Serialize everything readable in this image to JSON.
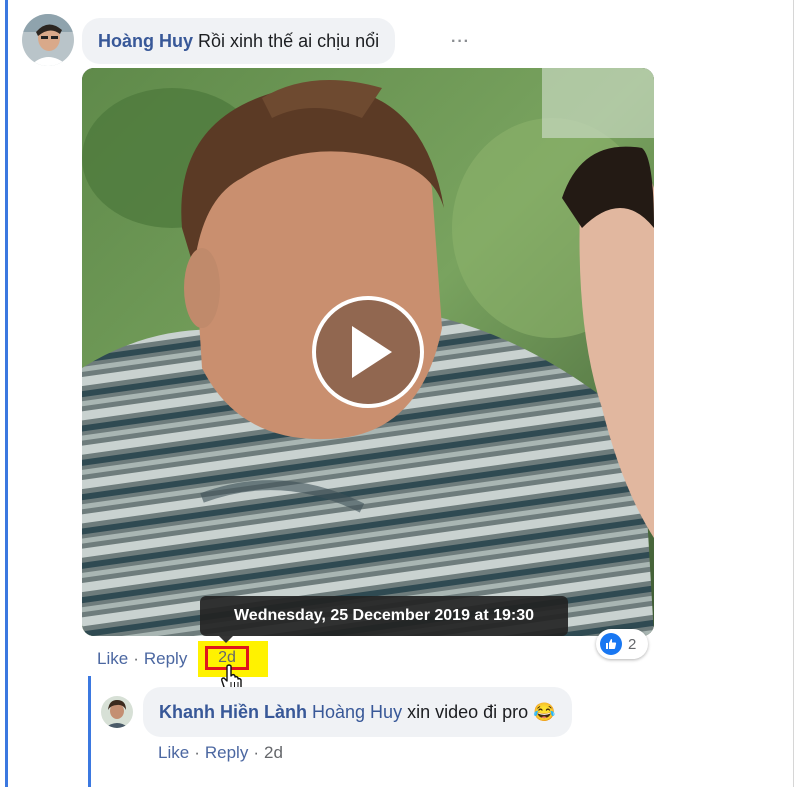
{
  "comment": {
    "author": "Hoàng Huy",
    "text": "Rồi xinh thế ai chịu nổi",
    "more_icon": "···",
    "like_label": "Like",
    "reply_label": "Reply",
    "separator": "·",
    "timestamp": "2d",
    "reaction_count": "2",
    "reaction_icon": "thumbs-up",
    "tooltip": "Wednesday, 25 December 2019 at 19:30"
  },
  "reply": {
    "author": "Khanh Hiền Lành",
    "mention": "Hoàng Huy",
    "text": "xin video đi pro",
    "emoji": "😂",
    "like_label": "Like",
    "reply_label": "Reply",
    "separator": "·",
    "timestamp": "2d"
  },
  "colors": {
    "name": "#385898",
    "link": "#4b67a1",
    "thread_line": "#3b78e0",
    "highlight": "#fff200",
    "annotation_box": "#e0151c"
  }
}
